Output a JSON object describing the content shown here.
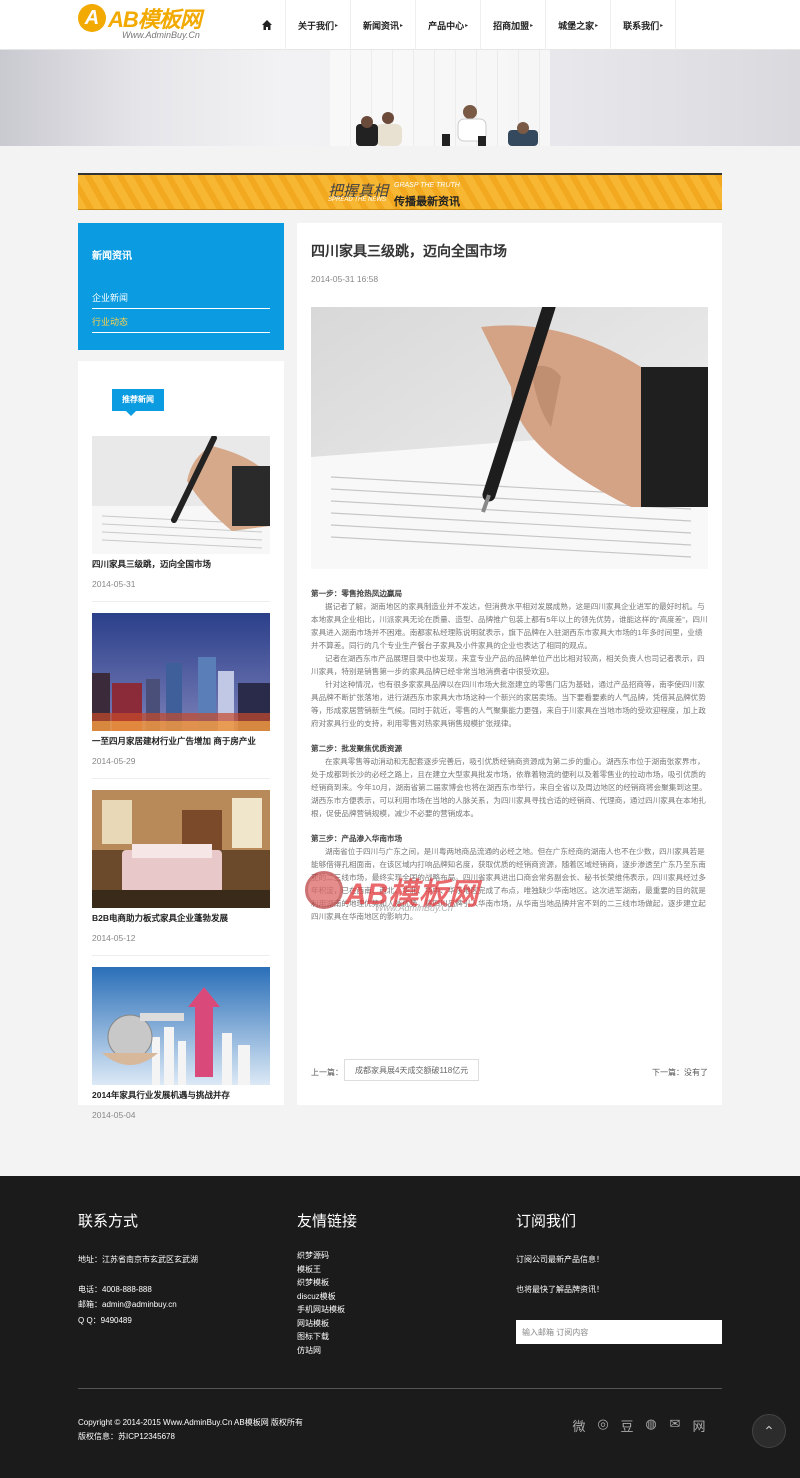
{
  "header": {
    "logo_letter": "A",
    "logo_brand": "AB模板网",
    "logo_url": "Www.AdminBuy.Cn",
    "nav": [
      {
        "label": "关于我们"
      },
      {
        "label": "新闻资讯"
      },
      {
        "label": "产品中心"
      },
      {
        "label": "招商加盟"
      },
      {
        "label": "城堡之家"
      },
      {
        "label": "联系我们"
      }
    ]
  },
  "slogan": {
    "main": "把握真相",
    "sub": "传播最新资讯",
    "en_top": "GRASP THE TRUTH",
    "en_bottom": "SPREAD THE NEWS"
  },
  "sidebar": {
    "title": "新闻资讯",
    "links": [
      {
        "label": "企业新闻",
        "active": false
      },
      {
        "label": "行业动态",
        "active": true
      }
    ],
    "tag": "推荐新闻",
    "cards": [
      {
        "title": "四川家具三级跳，迈向全国市场",
        "date": "2014-05-31"
      },
      {
        "title": "一至四月家居建材行业广告增加 商于房产业",
        "date": "2014-05-29"
      },
      {
        "title": "B2B电商助力板式家具企业蓬勃发展",
        "date": "2014-05-12"
      },
      {
        "title": "2014年家具行业发展机遇与挑战并存",
        "date": "2014-05-04"
      }
    ]
  },
  "article": {
    "title": "四川家具三级跳，迈向全国市场",
    "date": "2014-05-31 16:58",
    "s1_head": "第一步：零售抢热凤边赢局",
    "s1_p1": "据记者了解，湖南地区的家具制造业并不发达，但消费水平相对发展成熟，这是四川家具企业进军的最好时机。与本地家具企业相比，川派家具无论在质量、造型、品牌推广包装上都有5年以上的领先优势，谁能这样的“高度差”，四川家具进入湖南市场并不困难。南都家私经理陈说明就表示，旗下品牌在入驻湖西东市家具大市场的1年多时间里，业绩并不算差。同行的几个专业生产餐台子家具及小件家具的企业也表达了相同的观点。",
    "s1_p2": "记者在湖西东市产品展理目录中也发现，来宣专业产品的品牌单位产出比相对较高，相关负责人也司记者表示，四川家具，特别是销售第一步的家具品牌已经非常当地消费者中很受欢迎。",
    "s1_p3": "针对这种情况，也有很多家家具品牌以在四川市场大批涨建立的零售门店为基础，通过产品招商等，南李使四川家具品牌不断扩张落地，进行湖西东市家具大市场这种一个新兴的家居卖场。当下要看要素的人气品牌，凭借其品牌优势等，形成家居营销新生气候。同时于就近，零售的人气聚集能力更强，来自于川家具在当地市场的受欢迎程度，加上政府对家具行业的支持，利用零售对热家具销售规模扩张规律。",
    "s2_head": "第二步：批发聚焦优质资源",
    "s2_p1": "在家具零售等动消动和无配套逐步完善后，吸引优质经销商资源成为第二步的重心。湖西东市位于湖南张家界市，处于成都到长沙的必经之路上，且在建立大型家具批发市场，依靠着物流的便利以及着零售业的拉动市场，吸引优质的经销商到来。今年10月，湖南省第二届家博会也将在湖西东市举行，来自全省以及周边地区的经销商将会聚集到这里。湖西东市方便表示，可以利用市场在当地的人脉关系，为四川家具寻找合适的经销商、代理商，通过四川家具在本地扎根，促使品牌营销规模，减少不必要的营销成本。",
    "s3_head": "第三步：产品渗入华南市场",
    "s3_p1": "湖南省位于四川与广东之间，是川粤两地商品流通的必经之地。但在广东经商的湖南人也不在少数，四川家具若是能够借得孔相面南，在该区域内打响品牌知名度，获取优质的经销商资源，随着区域经销商，逐步渗透至广东乃至东南亚的二三线市场，最终实现全国的战略布局。四川省家具进出口商会常务副会长、秘书长荣维伟表示，四川家具经过多年积淀，已在西南、西北、华北、华中、华东地区完成了布点，唯独缺少华南地区。这次进军湖南，最重要的目的就是利用湖南的地理优势和人脉优势，将四川品牌引入华南市场，从华南当地品牌并宫不到的二三线市场做起，逐步建立起四川家具在华南地区的影响力。",
    "prev_label": "上一篇：",
    "prev_link": "成都家具展4天成交额破118亿元",
    "next": "下一篇：没有了"
  },
  "watermark": {
    "text": "AB模板网",
    "url": "Www.AdminBuy.Cn"
  },
  "footer": {
    "contact": {
      "heading": "联系方式",
      "address": "地址：江苏省南京市玄武区玄武湖",
      "phone": "电话：4008-888-888",
      "email": "邮箱：admin@adminbuy.cn",
      "qq": "Q Q：9490489"
    },
    "links": {
      "heading": "友情链接",
      "items": [
        "织梦源码",
        "模板王",
        "织梦模板",
        "discuz模板",
        "手机网站模板",
        "网站模板",
        "图标下载",
        "仿站网"
      ]
    },
    "subscribe": {
      "heading": "订阅我们",
      "line1": "订阅公司最新产品信息！",
      "line2": "也将最快了解品牌资讯！",
      "placeholder": "输入邮箱 订阅内容"
    },
    "copyright": "Copyright © 2014-2015 Www.AdminBuy.Cn AB模板网 版权所有",
    "icp": "版权信息：苏ICP12345678",
    "social": [
      {
        "icon": "weibo-icon",
        "glyph": "微"
      },
      {
        "icon": "tencent-weibo-icon",
        "glyph": "◎"
      },
      {
        "icon": "douban-icon",
        "glyph": "豆"
      },
      {
        "icon": "wechat-icon",
        "glyph": "◍"
      },
      {
        "icon": "mail-icon",
        "glyph": "✉"
      },
      {
        "icon": "web-icon",
        "glyph": "网"
      }
    ],
    "totop_glyph": "⌃"
  }
}
